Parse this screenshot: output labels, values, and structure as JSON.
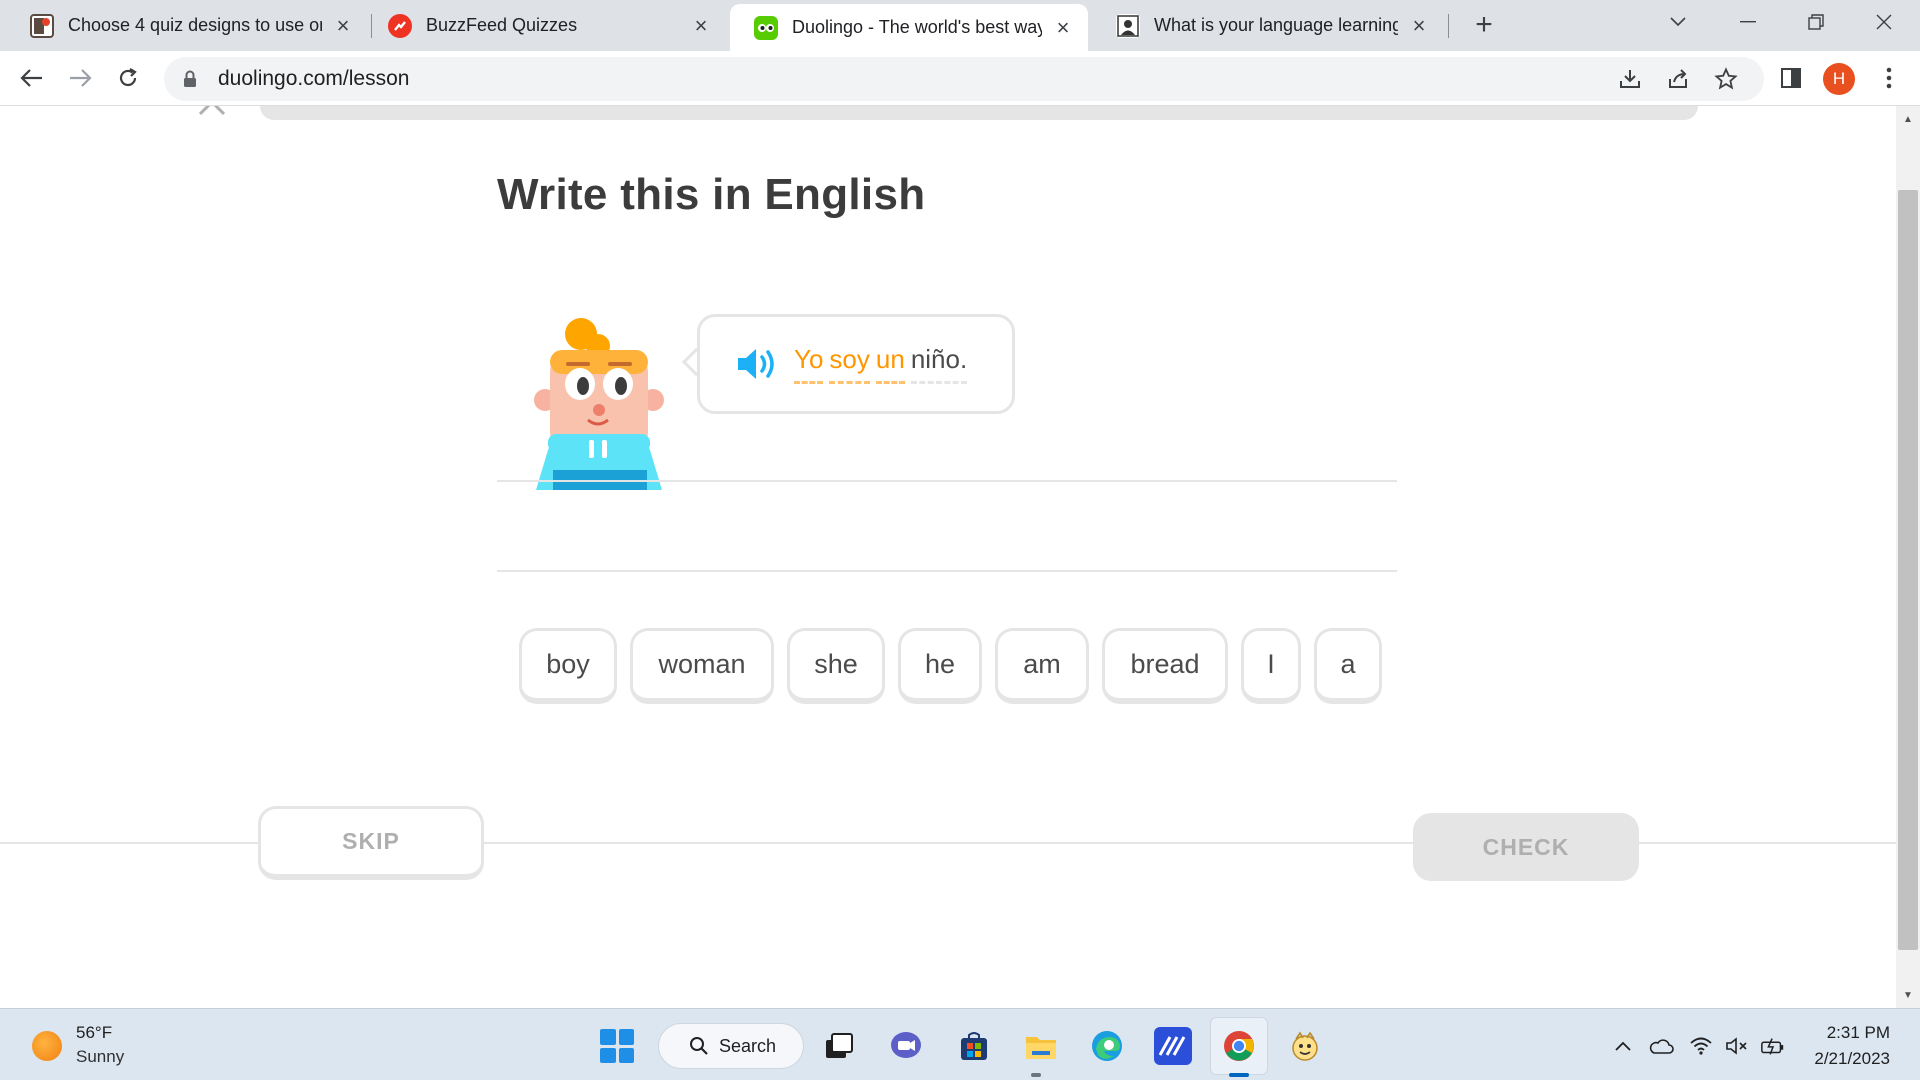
{
  "browser": {
    "tabs": [
      {
        "title": "Choose 4 quiz designs to use on",
        "favicon": "quiz-app-icon",
        "active": false
      },
      {
        "title": "BuzzFeed Quizzes",
        "favicon": "buzzfeed-icon",
        "active": false
      },
      {
        "title": "Duolingo - The world's best way",
        "favicon": "duolingo-icon",
        "active": true
      },
      {
        "title": "What is your language learning s",
        "favicon": "quiz-person-icon",
        "active": false
      }
    ],
    "new_tab": "+",
    "url": "duolingo.com/lesson",
    "profile_initial": "H",
    "accent": "#e8501f"
  },
  "lesson": {
    "prompt": "Write this in English",
    "sentence": [
      {
        "text": "Yo",
        "hint": true
      },
      {
        "text": "soy",
        "hint": true
      },
      {
        "text": "un",
        "hint": true
      },
      {
        "text": "niño.",
        "hint": false
      }
    ],
    "word_bank": [
      "boy",
      "woman",
      "she",
      "he",
      "am",
      "bread",
      "I",
      "a"
    ],
    "skip_label": "SKIP",
    "check_label": "CHECK",
    "hint_color": "#ff9600",
    "speaker_color": "#1cb0f6"
  },
  "taskbar": {
    "weather_temp": "56°F",
    "weather_condition": "Sunny",
    "search_label": "Search",
    "time": "2:31 PM",
    "date": "2/21/2023"
  }
}
